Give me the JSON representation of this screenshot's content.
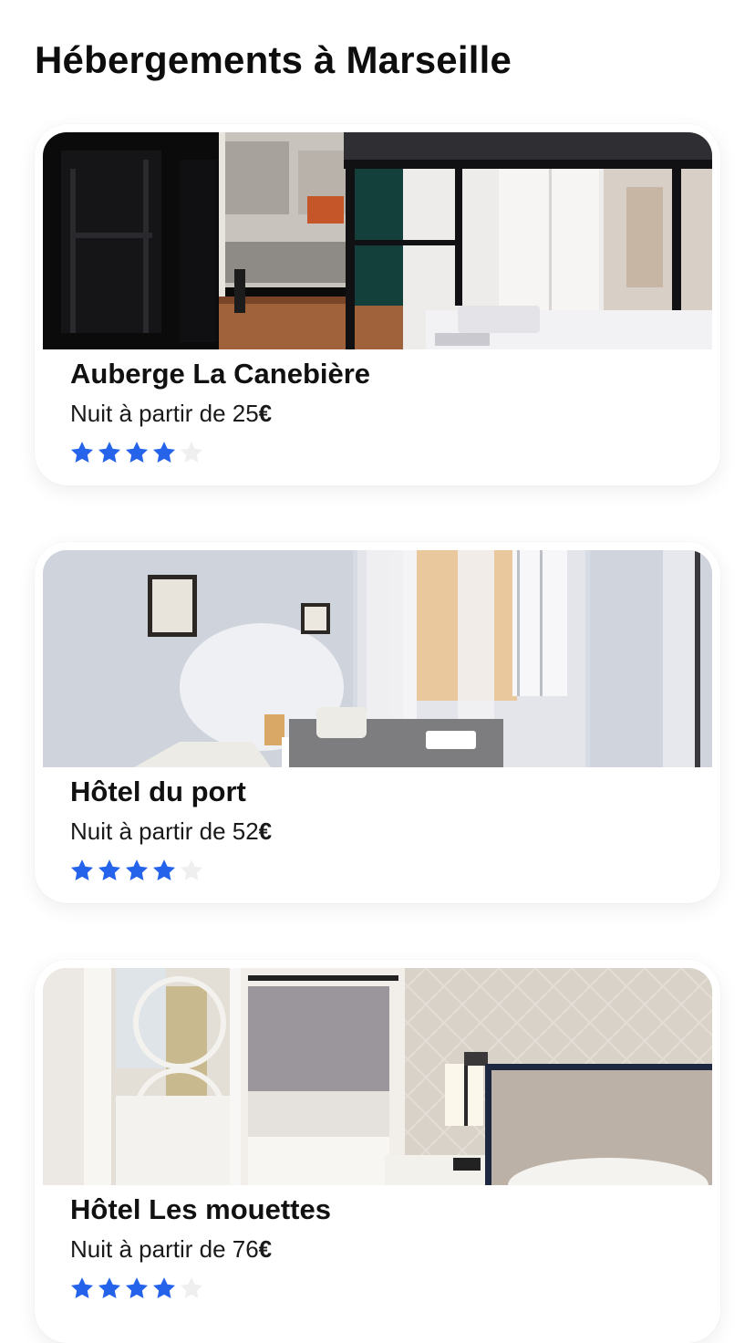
{
  "page": {
    "title": "Hébergements à Marseille"
  },
  "colors": {
    "star_filled": "#2563EB",
    "star_empty": "#EFEFEF"
  },
  "listings": [
    {
      "name": "Auberge La Canebière",
      "price_prefix": "Nuit à partir de 25",
      "currency": "€",
      "rating": 4,
      "rating_max": 5,
      "image": "hostel-dorm-bunk-bed-window-photo"
    },
    {
      "name": "Hôtel du port",
      "price_prefix": "Nuit à partir de 52",
      "currency": "€",
      "rating": 4,
      "rating_max": 5,
      "image": "hotel-room-twin-beds-window-photo"
    },
    {
      "name": "Hôtel Les mouettes",
      "price_prefix": "Nuit à partir de 76",
      "currency": "€",
      "rating": 4,
      "rating_max": 5,
      "image": "hotel-room-bed-lamp-wardrobe-photo"
    }
  ]
}
